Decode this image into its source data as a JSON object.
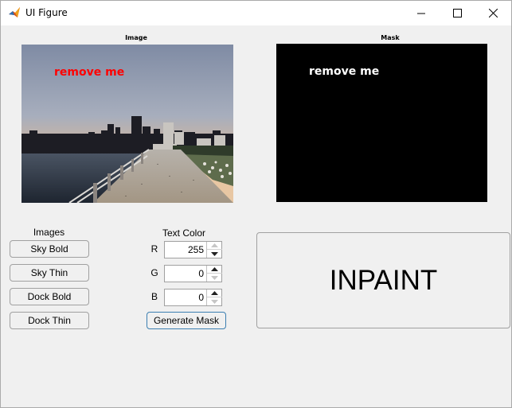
{
  "window": {
    "title": "UI Figure",
    "controls": {
      "minimize": "minimize-icon",
      "maximize": "maximize-icon",
      "close": "close-icon"
    }
  },
  "image_panel": {
    "label": "Image",
    "overlay_text": "remove me",
    "overlay_color": "#ff0000"
  },
  "mask_panel": {
    "label": "Mask",
    "overlay_text": "remove me",
    "background": "#000000",
    "overlay_color": "#ffffff"
  },
  "images_group": {
    "heading": "Images",
    "buttons": [
      "Sky Bold",
      "Sky Thin",
      "Dock Bold",
      "Dock Thin"
    ]
  },
  "text_color": {
    "heading": "Text Color",
    "channels": [
      {
        "label": "R",
        "value": "255"
      },
      {
        "label": "G",
        "value": "0"
      },
      {
        "label": "B",
        "value": "0"
      }
    ],
    "generate_label": "Generate Mask"
  },
  "inpaint": {
    "label": "INPAINT"
  },
  "colors": {
    "accent_border": "#3c7fb1"
  }
}
